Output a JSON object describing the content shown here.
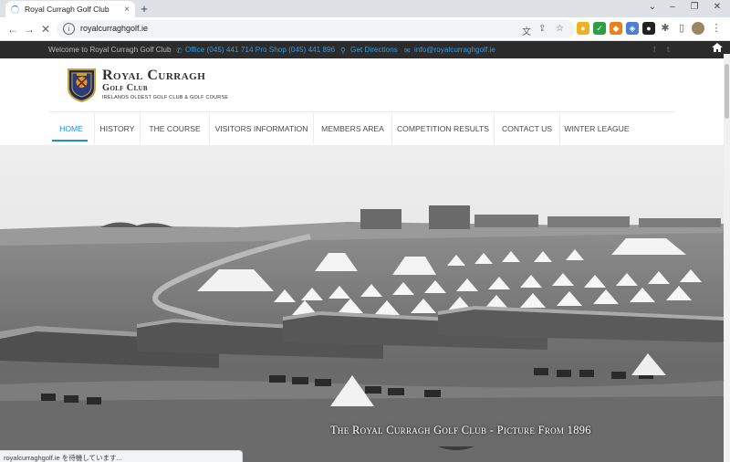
{
  "browser": {
    "tab_title": "Royal Curragh Golf Club",
    "tab_close": "×",
    "new_tab": "+",
    "url": "royalcurraghgolf.ie",
    "status_text": "royalcurraghgolf.ie を待機しています..."
  },
  "topbar": {
    "welcome": "Welcome to Royal Curragh Golf Club",
    "phone": "Office (045) 441 714 Pro Shop (045) 441 896",
    "directions": "Get Directions",
    "email": "info@royalcurraghgolf.ie",
    "social": [
      "facebook-icon",
      "twitter-icon"
    ]
  },
  "brand": {
    "name": "Royal Curragh",
    "subname": "Golf Club",
    "tagline": "IRELANDS OLDEST GOLF CLUB & GOLF COURSE"
  },
  "nav": {
    "items": [
      {
        "label": "HOME",
        "active": true
      },
      {
        "label": "HISTORY",
        "active": false
      },
      {
        "label": "THE COURSE",
        "active": false
      },
      {
        "label": "VISITORS INFORMATION",
        "active": false
      },
      {
        "label": "MEMBERS AREA",
        "active": false
      },
      {
        "label": "COMPETITION RESULTS",
        "active": false
      },
      {
        "label": "CONTACT US",
        "active": false
      },
      {
        "label": "WINTER LEAGUE",
        "active": false
      }
    ]
  },
  "hero": {
    "caption": "The Royal Curragh Golf Club -  Picture From 1896"
  },
  "colors": {
    "accent": "#1c8fd6",
    "topbar_bg": "#2b2b2b",
    "link_blue": "#3a9ad9"
  }
}
